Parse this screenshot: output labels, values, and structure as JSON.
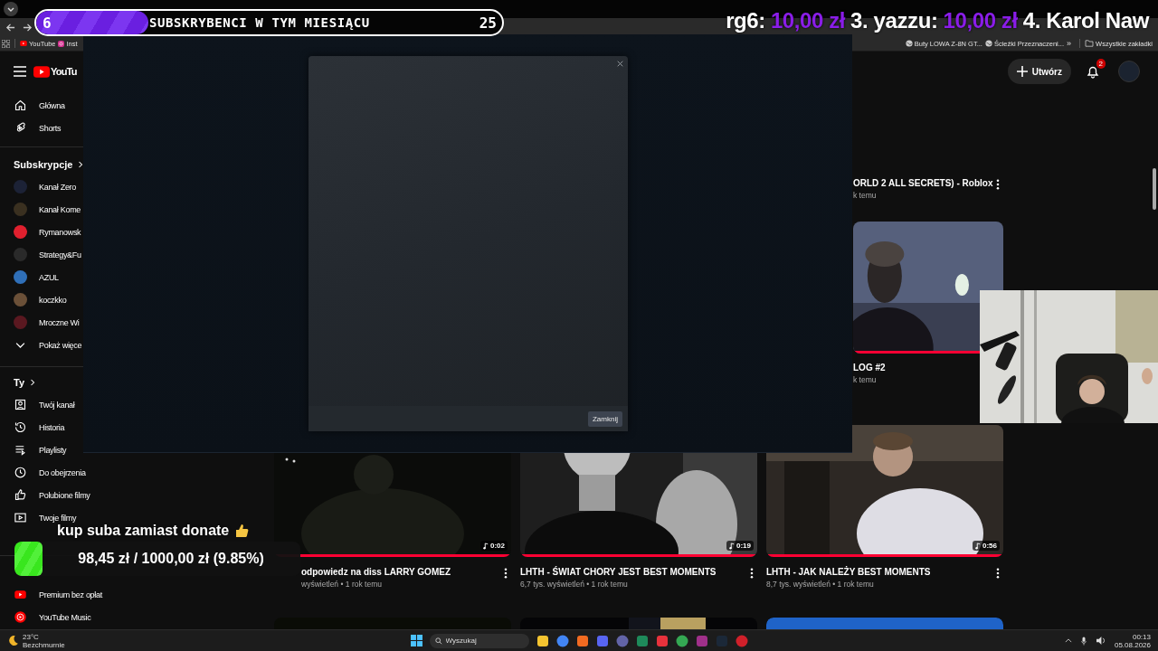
{
  "stream_overlay": {
    "sub_goal": {
      "current": "6",
      "label": "SUBSKRYBENCI W TYM MIESIĄCU",
      "target": "25",
      "level": 0.24
    },
    "donation_ticker": [
      {
        "kind": "name",
        "text": "rg6:"
      },
      {
        "kind": "amount",
        "text": "10,00 zł"
      },
      {
        "kind": "name",
        "text": "3. yazzu:"
      },
      {
        "kind": "amount",
        "text": "10,00 zł"
      },
      {
        "kind": "name",
        "text": "4. Karol Naw"
      }
    ],
    "donation_goal": {
      "title": "kup suba zamiast donate",
      "progress": "98,45 zł / 1000,00 zł (9.85%)",
      "level": 0.0985
    }
  },
  "browser": {
    "bookmarks_left": [
      {
        "label": "YouTube",
        "kind": "youtube"
      },
      {
        "label": "Inst",
        "kind": "instagram"
      }
    ],
    "bookmarks_right": [
      {
        "label": "Buty LOWA Z-8N GT..."
      },
      {
        "label": "Ścieżki Przeznaczeni..."
      }
    ],
    "more": "»",
    "all_bookmarks": "Wszystkie zakładki"
  },
  "youtube": {
    "logo": "YouTu",
    "create_button": "Utwórz",
    "notification_count": "2",
    "sidebar": {
      "main": [
        {
          "label": "Główna"
        },
        {
          "label": "Shorts"
        }
      ],
      "subscriptions_heading": "Subskrypcje",
      "subscriptions": [
        {
          "label": "Kanał Zero",
          "color": "#1c2236"
        },
        {
          "label": "Kanał Kome",
          "color": "#3a3020"
        },
        {
          "label": "Rymanowsk",
          "color": "#e0202e"
        },
        {
          "label": "Strategy&Fu",
          "color": "#2a2a2a"
        },
        {
          "label": "AZUL",
          "color": "#2f6fb8"
        },
        {
          "label": "koczkko",
          "color": "#6b5038"
        },
        {
          "label": "Mroczne Wi",
          "color": "#5a1820"
        }
      ],
      "show_more": "Pokaż więce",
      "you_heading": "Ty",
      "you": [
        {
          "label": "Twój kanał"
        },
        {
          "label": "Historia"
        },
        {
          "label": "Playlisty"
        },
        {
          "label": "Do obejrzenia"
        },
        {
          "label": "Polubione filmy"
        },
        {
          "label": "Twoje filmy"
        }
      ],
      "more_from": [
        {
          "label": "Premium bez opłat"
        },
        {
          "label": "YouTube Music"
        }
      ]
    },
    "right_column_videos": [
      {
        "title": "ORLD 2 ALL SECRETS) - Roblox",
        "meta": "k temu",
        "menu": true
      },
      {
        "kind": "picture",
        "level": 1,
        "title": "LOG #2",
        "meta": "k temu",
        "menu": false
      }
    ],
    "video_row": [
      {
        "kind": "picture",
        "duration": "0:02",
        "level": 1,
        "title": "odpowiedz na diss LARRY GOMEZ",
        "meta": "wyświetleń • 1 rok temu"
      },
      {
        "kind": "picture",
        "duration": "0:19",
        "level": 1,
        "title": "LHTH - ŚWIAT CHORY JEST BEST MOMENTS",
        "meta": "6,7 tys. wyświetleń • 1 rok temu"
      },
      {
        "kind": "picture",
        "duration": "0:56",
        "level": 1,
        "title": "LHTH - JAK NALEŻY BEST MOMENTS",
        "meta": "8,7 tys. wyświetleń • 1 rok temu"
      }
    ]
  },
  "dialog": {
    "close_button": "Zamknij"
  },
  "taskbar": {
    "temperature": "23°C",
    "weather": "Bezchmurnie",
    "search_placeholder": "Wyszukaj",
    "time": "00:13",
    "date": "05.08.2026"
  }
}
